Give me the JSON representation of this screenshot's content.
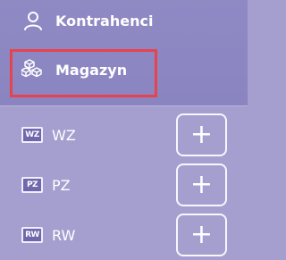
{
  "top": {
    "contractors": {
      "label": "Kontrahenci",
      "icon": "user-icon"
    },
    "warehouse": {
      "label": "Magazyn",
      "icon": "boxes-icon"
    }
  },
  "documents": [
    {
      "code": "WZ",
      "label": "WZ",
      "icon_text": "WZ",
      "action": "+"
    },
    {
      "code": "PZ",
      "label": "PZ",
      "icon_text": "PZ",
      "action": "+"
    },
    {
      "code": "RW",
      "label": "RW",
      "icon_text": "RW",
      "action": "+"
    }
  ],
  "colors": {
    "top_bg": "#8f89c4",
    "list_bg": "#a49fce",
    "highlight": "#e7434e"
  }
}
